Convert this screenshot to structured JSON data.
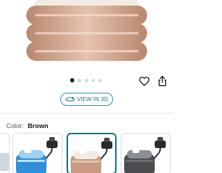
{
  "product": {
    "images_total": 5,
    "active_image_index": 0
  },
  "actions": {
    "heart_icon": "heart-outline-icon",
    "share_icon": "share-icon",
    "view_in_3d_label": "VIEW IN 3D"
  },
  "variation": {
    "label": "Color:",
    "selected": "Brown",
    "swatches": [
      {
        "color": "#3d9be0",
        "icon": "blue-tub-thumbnail"
      },
      {
        "color": "#c89a82",
        "icon": "brown-tub-thumbnail",
        "selected": true
      },
      {
        "color": "#4a4c50",
        "icon": "gray-tub-thumbnail"
      }
    ]
  },
  "colors": {
    "accent": "#007185",
    "tub_rose": "#c89a82",
    "tub_cream": "#f2ebe4"
  }
}
